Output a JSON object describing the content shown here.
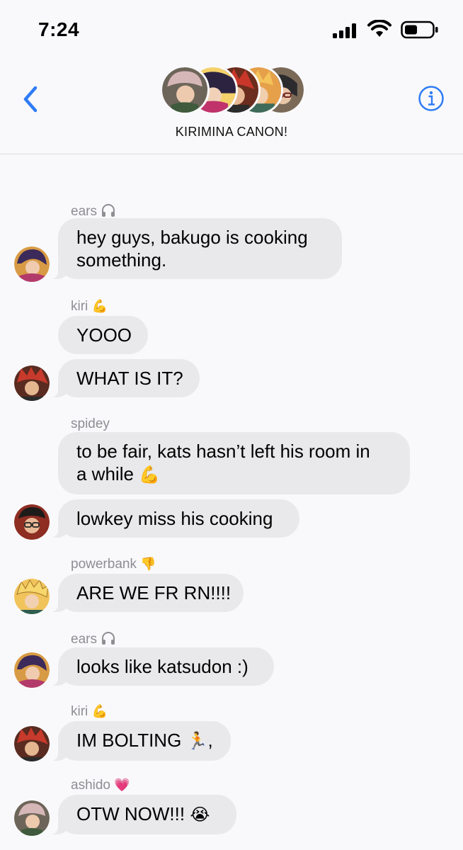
{
  "status_bar": {
    "time": "7:24",
    "icons": [
      "signal-icon",
      "wifi-icon",
      "battery-icon"
    ]
  },
  "header": {
    "title": "KIRIMINA CANON!",
    "back_icon": "chevron-left-icon",
    "info_icon": "info-icon",
    "accent_color": "#2f7cf6"
  },
  "messages": [
    {
      "sender": "ears",
      "sender_emoji": "🎧",
      "text": "hey guys, bakugo is cooking",
      "text2": "something."
    },
    {
      "sender": "kiri",
      "sender_emoji": "💪",
      "text": "YOOO"
    },
    {
      "text": "WHAT IS IT?"
    },
    {
      "sender": "spidey",
      "text": "to be fair, kats hasn’t left his room in",
      "text2": "a while"
    },
    {
      "text": "lowkey miss his cooking"
    },
    {
      "sender": "powerbank",
      "sender_emoji": "👎",
      "text": "ARE WE FR RN!!!!"
    },
    {
      "sender": "ears",
      "sender_emoji": "🎧",
      "text": "looks like katsudon :)"
    },
    {
      "sender": "kiri",
      "sender_emoji": "💪",
      "text": "IM BOLTING",
      "trailing": ","
    },
    {
      "sender": "ashido",
      "sender_emoji": "💗",
      "text": "OTW NOW!!!"
    }
  ],
  "colors": {
    "bubble": "#e9e9eb",
    "background": "#f9f9fb",
    "sender_name": "#8e8e93"
  }
}
